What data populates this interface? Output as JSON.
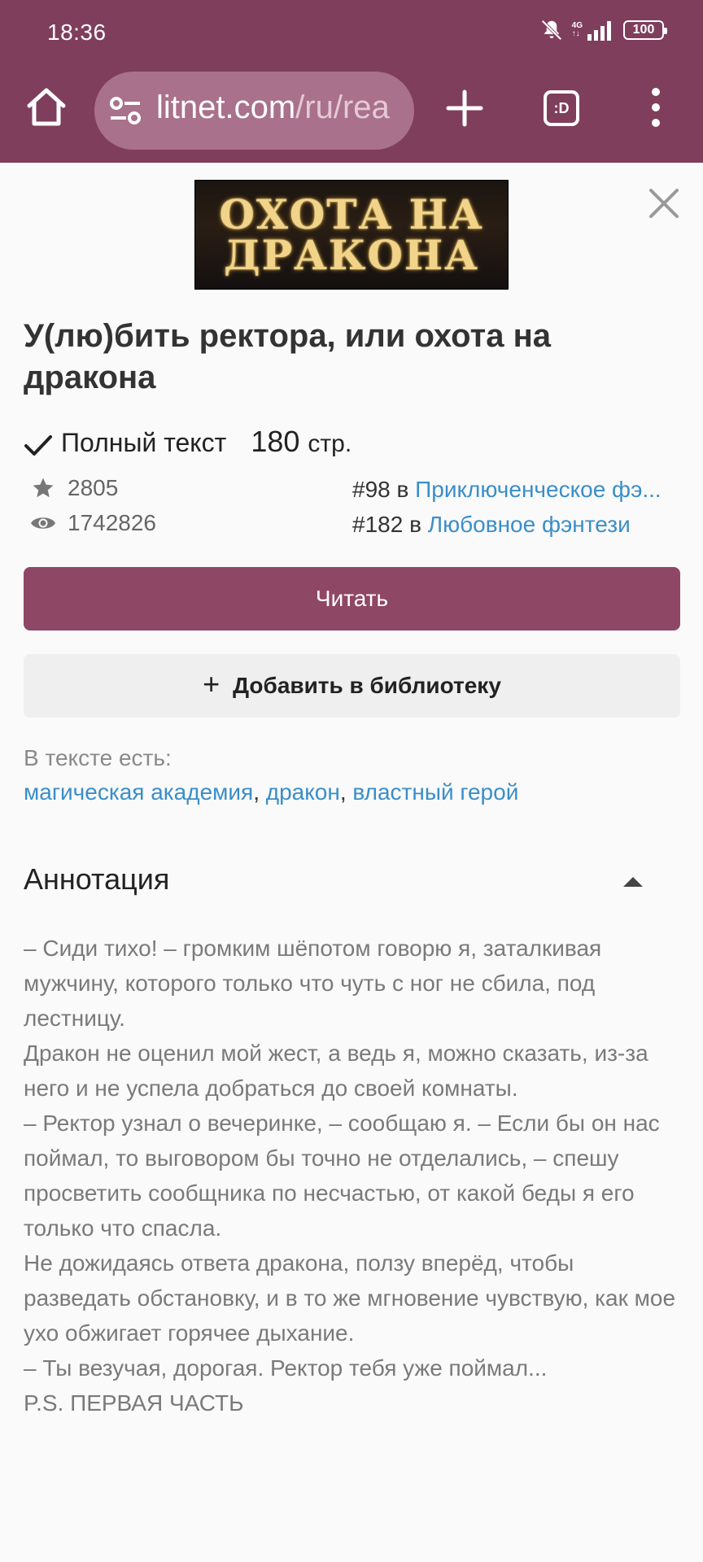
{
  "status_bar": {
    "time": "18:36",
    "net_top": "4G",
    "net_bottom": "↑↓",
    "battery": "100",
    "icons": [
      "mute-icon",
      "signal-icon",
      "battery-icon"
    ]
  },
  "browser": {
    "url_main": "litnet.com",
    "url_rest": "/ru/rea",
    "tabs_label": ":D",
    "icons": [
      "home-icon",
      "site-settings-icon",
      "new-tab-plus-icon",
      "tab-switcher-icon",
      "overflow-menu-icon"
    ]
  },
  "book": {
    "cover_line1": "ОХОТА НА",
    "cover_line2": "ДРАКОНА",
    "title": "У(лю)бить ректора, или охота на дракона",
    "full_text_label": "Полный текст",
    "pages_count": "180",
    "pages_unit": "стр.",
    "rating": "2805",
    "views": "1742826",
    "rank1_prefix": "#98 в ",
    "rank1_genre": "Приключенческое фэ...",
    "rank2_prefix": "#182 в ",
    "rank2_genre": "Любовное фэнтези"
  },
  "actions": {
    "read": "Читать",
    "add": "Добавить в библиотеку"
  },
  "tags": {
    "label": "В тексте есть:",
    "items": [
      "магическая академия",
      "дракон",
      "властный герой"
    ],
    "sep": ", "
  },
  "annotation": {
    "heading": "Аннотация",
    "paragraphs": [
      "– Сиди тихо! – громким шёпотом говорю я, заталкивая мужчину, которого только что чуть с ног не сбила, под лестницу.",
      "Дракон не оценил мой жест, а ведь я, можно сказать, из-за него и не успела добраться до своей комнаты.",
      "– Ректор узнал о вечеринке, – сообщаю я. – Если бы он нас поймал, то выговором бы точно не отделались, – спешу просветить сообщника по несчастью, от какой беды я его только что спасла.",
      "Не дожидаясь ответа дракона, ползу вперёд, чтобы разведать обстановку, и в то же мгновение чувствую, как мое ухо обжигает горячее дыхание.",
      "– Ты везучая, дорогая. Ректор тебя уже поймал...",
      "P.S. ПЕРВАЯ ЧАСТЬ"
    ]
  },
  "colors": {
    "browser_bar": "#7f3e5c",
    "read_button": "#8f4766",
    "link": "#3a8ec9"
  }
}
